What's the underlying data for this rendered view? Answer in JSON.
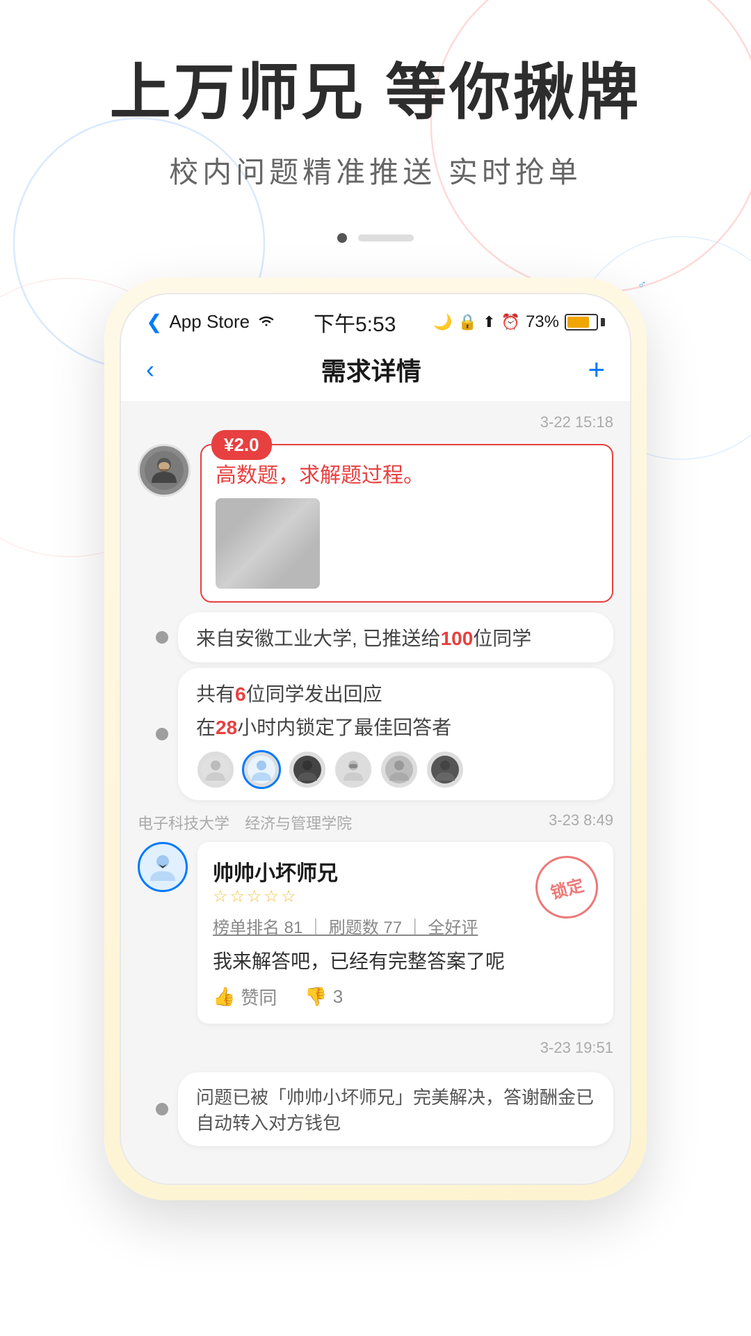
{
  "hero": {
    "title": "上万师兄 等你揪牌",
    "subtitle": "校内问题精准推送  实时抢单"
  },
  "pagination": {
    "active_dot": 0,
    "total_dots": 2
  },
  "phone": {
    "status_bar": {
      "left": "App Store",
      "wifi_icon": "wifi",
      "time": "下午5:53",
      "battery_percent": "73%"
    },
    "nav": {
      "back_label": "‹",
      "title": "需求详情",
      "action_label": "+"
    },
    "chat": {
      "timestamp1": "3-22 15:18",
      "price_badge": "¥2.0",
      "question_text": "高数题，求解题过程。",
      "info1": "来自安徽工业大学, 已推送给",
      "info1_highlight": "100",
      "info1_suffix": "位同学",
      "info2_line1": "共有",
      "info2_num1": "6",
      "info2_line1b": "位同学发出回应",
      "info2_line2": "在",
      "info2_num2": "28",
      "info2_line2b": "小时内锁定了最佳回答者",
      "school_name": "电子科技大学",
      "school_dept": "经济与管理学院",
      "timestamp2": "3-23 8:49",
      "answer_name": "帅帅小坏师兄",
      "answer_gender": "♂",
      "answer_stars": "☆☆☆☆☆",
      "answer_meta": "榜单排名 81 ｜ 刷题数 77 ｜ 全好评",
      "answer_text": "我来解答吧，已经有完整答案了呢",
      "lock_label": "锁定",
      "action_agree": "赞同",
      "action_disagree_count": "3",
      "timestamp3": "3-23 19:51",
      "notif_text": "问题已被「帅帅小坏师兄」完美解决，答谢酬金已自动转入对方钱包"
    }
  },
  "colors": {
    "accent_red": "#e84040",
    "accent_blue": "#007aff",
    "bg_light": "#f5f5f5",
    "text_dark": "#2d2d2d",
    "text_mid": "#666666"
  }
}
